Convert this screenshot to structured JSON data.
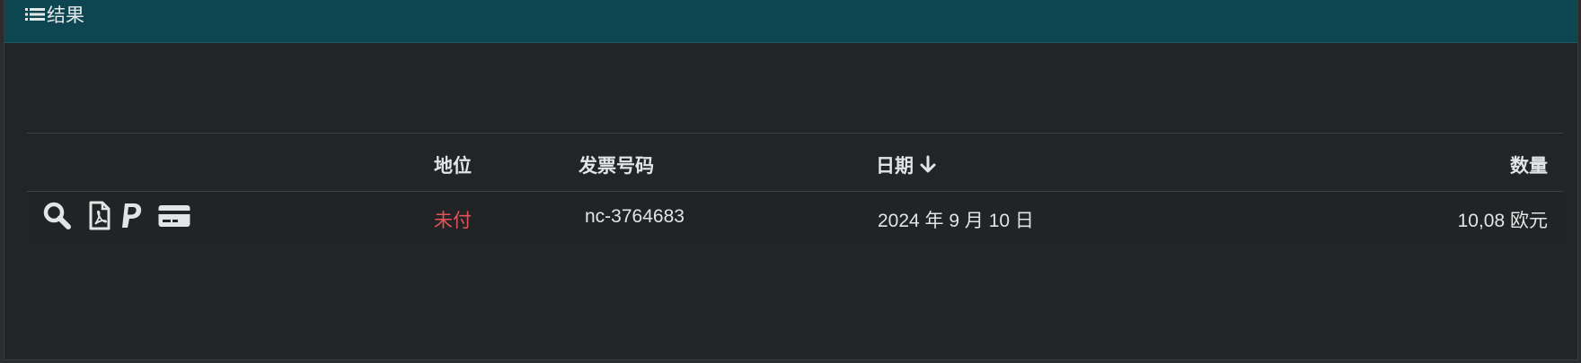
{
  "panel": {
    "title": "结果",
    "title_icon": "list-icon"
  },
  "table": {
    "columns": {
      "actions": "",
      "status": "地位",
      "invoice_number": "发票号码",
      "date": "日期",
      "amount": "数量"
    },
    "sort": {
      "column": "date",
      "direction": "descending",
      "icon": "arrow-down-icon"
    },
    "rows": [
      {
        "actions": [
          "search-icon",
          "pdf-file-icon",
          "paypal-icon",
          "credit-card-icon"
        ],
        "status": "未付",
        "invoice_number": "nc-3764683",
        "date": "2024 年 9 月 10 日",
        "amount": "10,08 欧元"
      }
    ]
  },
  "colors": {
    "header_bg": "#0d4651",
    "panel_bg": "#232425",
    "text": "#e3e4e5",
    "unpaid": "#e35259"
  }
}
